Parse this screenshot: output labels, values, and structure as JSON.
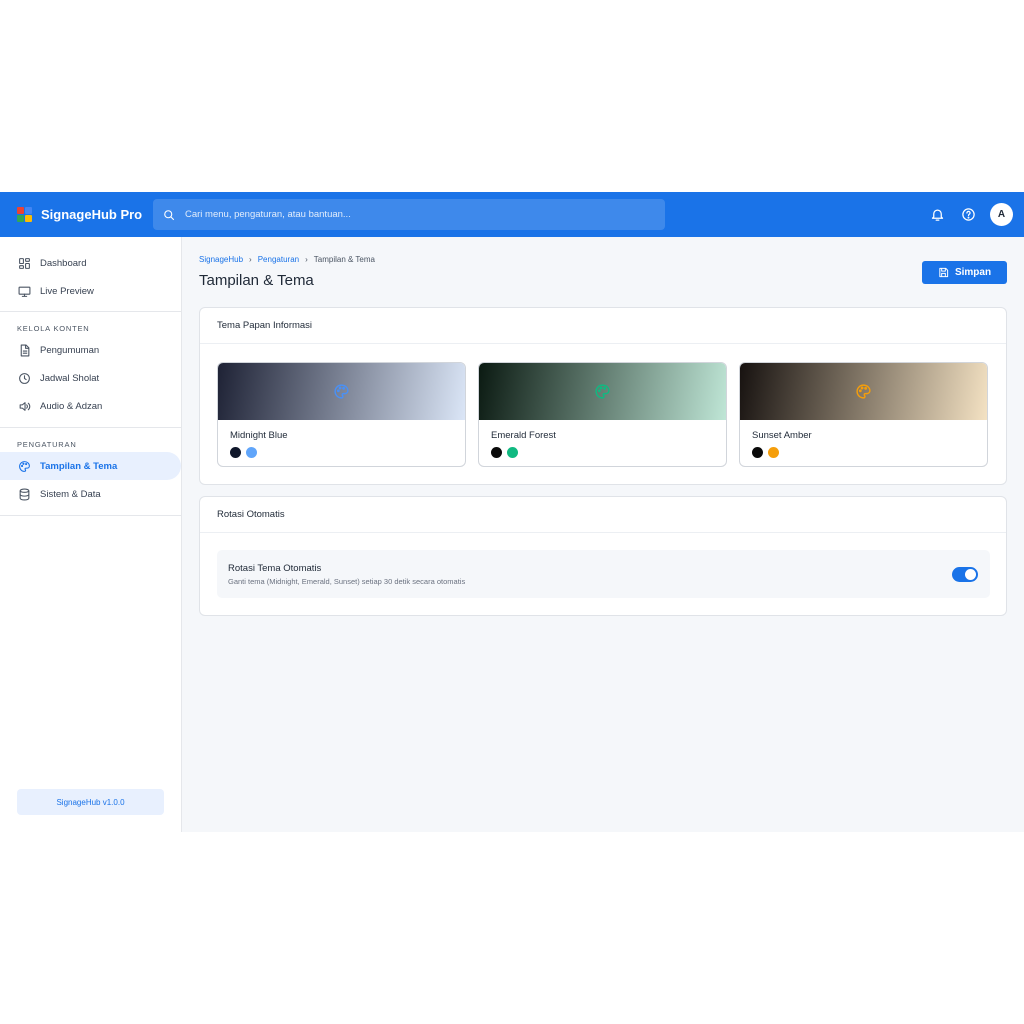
{
  "app": {
    "name": "SignageHub Pro",
    "logo_colors": [
      "#ea4335",
      "#4285f4",
      "#34a853",
      "#fbbc05"
    ]
  },
  "search": {
    "placeholder": "Cari menu, pengaturan, atau bantuan..."
  },
  "topbar": {
    "icons": [
      "bell-icon",
      "help-icon"
    ],
    "avatar_letter": "A"
  },
  "sidebar": {
    "items_top": [
      {
        "label": "Dashboard",
        "icon": "dashboard-icon"
      },
      {
        "label": "Live Preview",
        "icon": "monitor-icon"
      }
    ],
    "section_content": "KELOLA KONTEN",
    "items_content": [
      {
        "label": "Pengumuman",
        "icon": "document-icon"
      },
      {
        "label": "Jadwal Sholat",
        "icon": "clock-icon"
      },
      {
        "label": "Audio & Adzan",
        "icon": "speaker-icon"
      }
    ],
    "section_settings": "PENGATURAN",
    "items_settings": [
      {
        "label": "Tampilan & Tema",
        "icon": "palette-icon",
        "active": true
      },
      {
        "label": "Sistem & Data",
        "icon": "database-icon"
      }
    ],
    "version": "SignageHub v1.0.0"
  },
  "breadcrumb": [
    "SignageHub",
    "Pengaturan",
    "Tampilan & Tema"
  ],
  "page": {
    "title": "Tampilan & Tema",
    "save_label": "Simpan"
  },
  "themes_card": {
    "title": "Tema Papan Informasi",
    "themes": [
      {
        "name": "Midnight Blue",
        "gradient": [
          "#1e2235",
          "#dbe6f7"
        ],
        "icon_color": "#4a90f5",
        "swatches": [
          "#0f172a",
          "#60a5fa"
        ]
      },
      {
        "name": "Emerald Forest",
        "gradient": [
          "#0b1a12",
          "#bfe6d6"
        ],
        "icon_color": "#10b981",
        "swatches": [
          "#0a0a0a",
          "#10b981"
        ]
      },
      {
        "name": "Sunset Amber",
        "gradient": [
          "#171210",
          "#f4e2c3"
        ],
        "icon_color": "#f59e0b",
        "swatches": [
          "#0a0a0a",
          "#f59e0b"
        ]
      }
    ]
  },
  "rotation_card": {
    "title": "Rotasi Otomatis",
    "option_title": "Rotasi Tema Otomatis",
    "option_desc": "Ganti tema (Midnight, Emerald, Sunset) setiap 30 detik secara otomatis",
    "enabled": true
  },
  "colors": {
    "accent": "#1a73e8"
  }
}
